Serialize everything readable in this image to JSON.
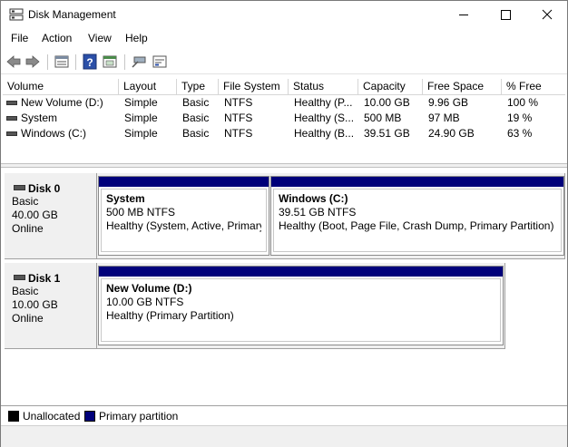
{
  "window": {
    "title": "Disk Management"
  },
  "menu": [
    "File",
    "Action",
    "View",
    "Help"
  ],
  "toolbar": {
    "buttons": [
      "back-arrow-icon",
      "forward-arrow-icon",
      "properties-icon",
      "help-icon",
      "console-icon",
      "rescan-icon",
      "settings-icon"
    ]
  },
  "volumes": {
    "columns": [
      "Volume",
      "Layout",
      "Type",
      "File System",
      "Status",
      "Capacity",
      "Free Space",
      "% Free"
    ],
    "rows": [
      [
        "New Volume (D:)",
        "Simple",
        "Basic",
        "NTFS",
        "Healthy (P...",
        "10.00 GB",
        "9.96 GB",
        "100 %"
      ],
      [
        "System",
        "Simple",
        "Basic",
        "NTFS",
        "Healthy (S...",
        "500 MB",
        "97 MB",
        "19 %"
      ],
      [
        "Windows (C:)",
        "Simple",
        "Basic",
        "NTFS",
        "Healthy (B...",
        "39.51 GB",
        "24.90 GB",
        "63 %"
      ]
    ]
  },
  "disks": [
    {
      "name": "Disk 0",
      "type": "Basic",
      "size": "40.00 GB",
      "status": "Online",
      "partitions": [
        {
          "name": "System",
          "size": "500 MB NTFS",
          "status": "Healthy (System, Active, Primary"
        },
        {
          "name": "Windows  (C:)",
          "size": "39.51 GB NTFS",
          "status": "Healthy (Boot, Page File, Crash Dump, Primary Partition)"
        }
      ]
    },
    {
      "name": "Disk 1",
      "type": "Basic",
      "size": "10.00 GB",
      "status": "Online",
      "partitions": [
        {
          "name": "New Volume  (D:)",
          "size": "10.00 GB NTFS",
          "status": "Healthy (Primary Partition)"
        }
      ]
    }
  ],
  "legend": [
    {
      "label": "Unallocated",
      "color": "#000000"
    },
    {
      "label": "Primary partition",
      "color": "#00007a"
    }
  ]
}
